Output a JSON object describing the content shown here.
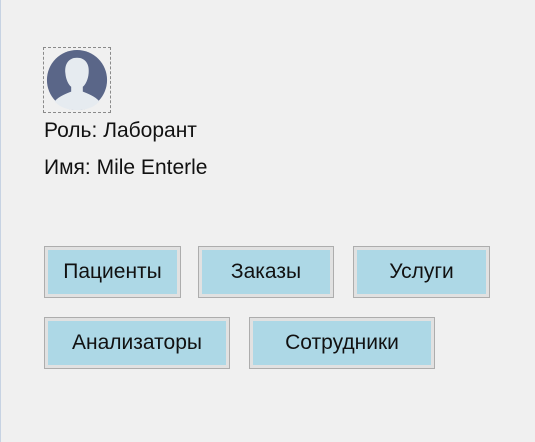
{
  "user": {
    "role_label": "Роль:",
    "role_value": "Лаборант",
    "name_label": "Имя:",
    "name_value": "Mile Enterle",
    "avatar_icon": "user-silhouette-icon"
  },
  "buttons": {
    "patients": "Пациенты",
    "orders": "Заказы",
    "services": "Услуги",
    "analyzers": "Анализаторы",
    "staff": "Сотрудники"
  },
  "colors": {
    "background": "#f0f0f0",
    "button_fill": "#add8e6",
    "button_border": "#adadad",
    "avatar_fill": "#5a6688",
    "avatar_bg": "#e6ebf0"
  }
}
